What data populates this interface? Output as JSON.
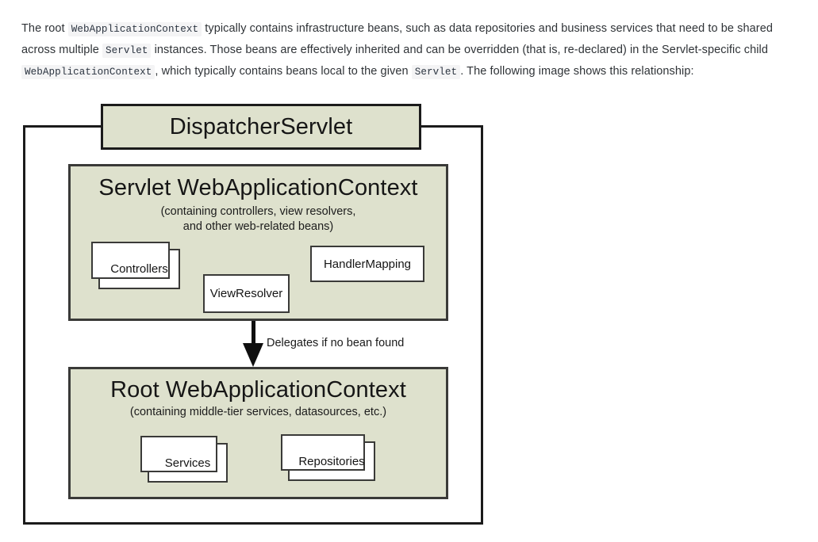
{
  "paragraph": {
    "segments": [
      {
        "type": "text",
        "value": "The root "
      },
      {
        "type": "code",
        "value": "WebApplicationContext"
      },
      {
        "type": "text",
        "value": " typically contains infrastructure beans, such as data repositories and business services that need to be shared across multiple "
      },
      {
        "type": "code",
        "value": "Servlet"
      },
      {
        "type": "text",
        "value": " instances. Those beans are effectively inherited and can be overridden (that is, re-declared) in the Servlet-specific child "
      },
      {
        "type": "code",
        "value": "WebApplicationContext"
      },
      {
        "type": "text",
        "value": ", which typically contains beans local to the given "
      },
      {
        "type": "code",
        "value": "Servlet"
      },
      {
        "type": "text",
        "value": ". The following image shows this relationship:"
      }
    ],
    "plain": "The root WebApplicationContext typically contains infrastructure beans, such as data repositories and business services that need to be shared across multiple Servlet instances. Those beans are effectively inherited and can be overridden (that is, re-declared) in the Servlet-specific child WebApplicationContext, which typically contains beans local to the given Servlet. The following image shows this relationship:"
  },
  "diagram": {
    "dispatcher": {
      "title": "DispatcherServlet"
    },
    "servlet_context": {
      "title": "Servlet WebApplicationContext",
      "subtitle": "(containing controllers, view resolvers,\nand other web-related beans)",
      "beans": [
        {
          "label": "Controllers",
          "stacked": true
        },
        {
          "label": "ViewResolver",
          "stacked": false
        },
        {
          "label": "HandlerMapping",
          "stacked": false
        }
      ]
    },
    "root_context": {
      "title": "Root WebApplicationContext",
      "subtitle": "(containing middle-tier services, datasources, etc.)",
      "beans": [
        {
          "label": "Services",
          "stacked": true
        },
        {
          "label": "Repositories",
          "stacked": true
        }
      ]
    },
    "arrow": {
      "label": "Delegates if no bean found",
      "direction": "down"
    },
    "colors": {
      "context_fill": "#dee1cd",
      "border": "#3a3a38",
      "outer_border": "#1b1b1b",
      "bean_fill": "#ffffff",
      "text": "#161616",
      "code_background": "#f4f4f5",
      "page_background": "#ffffff"
    }
  }
}
